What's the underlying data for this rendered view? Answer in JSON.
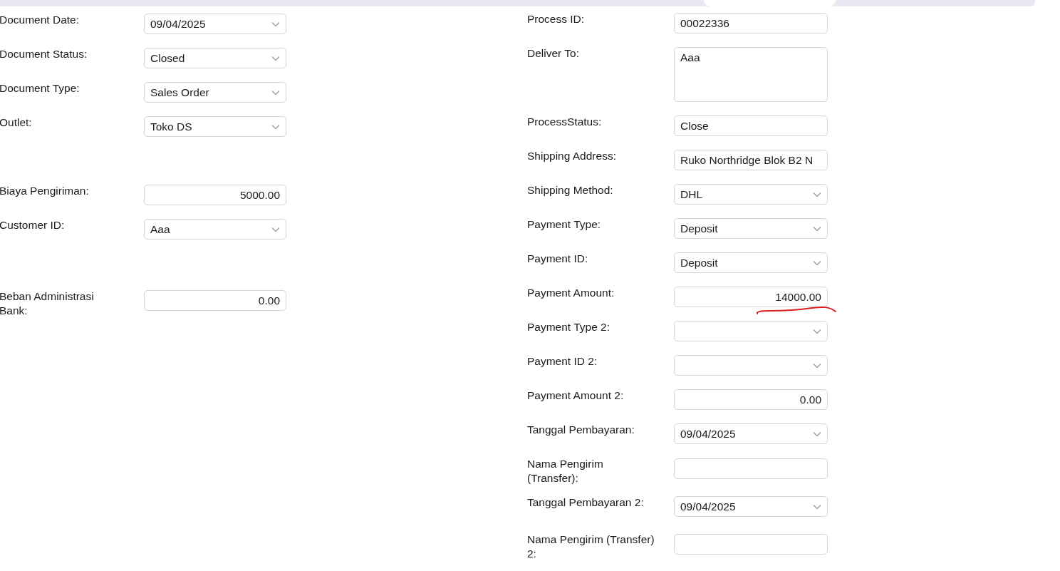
{
  "left_fields": [
    {
      "label": "Document Date:",
      "kind": "select",
      "value": "09/04/2025"
    },
    {
      "label": "Document Status:",
      "kind": "select",
      "value": "Closed"
    },
    {
      "label": "Document Type:",
      "kind": "select",
      "value": "Sales Order"
    },
    {
      "label": "Outlet:",
      "kind": "select",
      "value": "Toko DS"
    },
    {
      "label": "Biaya Pengiriman:",
      "kind": "number",
      "value": "5000.00"
    },
    {
      "label": "Customer ID:",
      "kind": "select",
      "value": "Aaa"
    },
    {
      "label": "Beban Administrasi Bank:",
      "kind": "number",
      "value": "0.00"
    }
  ],
  "right_fields": [
    {
      "label": "Process ID:",
      "kind": "text",
      "value": "00022336"
    },
    {
      "label": "Deliver To:",
      "kind": "textarea",
      "value": "Aaa"
    },
    {
      "label": "ProcessStatus:",
      "kind": "text",
      "value": "Close"
    },
    {
      "label": "Shipping Address:",
      "kind": "text",
      "value": "Ruko Northridge Blok B2 N"
    },
    {
      "label": "Shipping Method:",
      "kind": "select",
      "value": "DHL"
    },
    {
      "label": "Payment Type:",
      "kind": "select",
      "value": "Deposit"
    },
    {
      "label": "Payment ID:",
      "kind": "select",
      "value": "Deposit"
    },
    {
      "label": "Payment Amount:",
      "kind": "number",
      "value": "14000.00"
    },
    {
      "label": "Payment Type 2:",
      "kind": "select"
    },
    {
      "label": "Payment ID 2:",
      "kind": "select"
    },
    {
      "label": "Payment Amount 2:",
      "kind": "number",
      "value": "0.00"
    },
    {
      "label": "Tanggal Pembayaran:",
      "kind": "select",
      "value": "09/04/2025"
    },
    {
      "label": "Nama Pengirim (Transfer):",
      "kind": "text"
    },
    {
      "label": "Tanggal Pembayaran 2:",
      "kind": "select",
      "value": "09/04/2025"
    },
    {
      "label": "Nama Pengirim (Transfer) 2:",
      "kind": "text"
    }
  ]
}
